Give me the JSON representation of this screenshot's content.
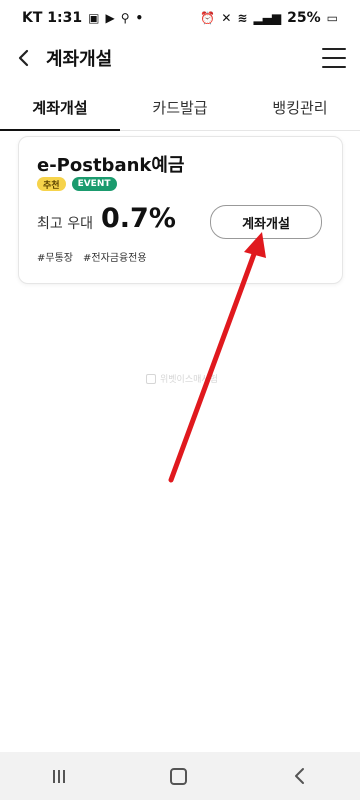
{
  "status_bar": {
    "carrier_time": "KT 1:31",
    "battery": "25%"
  },
  "header": {
    "title": "계좌개설"
  },
  "tabs": [
    {
      "label": "계좌개설",
      "active": true
    },
    {
      "label": "카드발급",
      "active": false
    },
    {
      "label": "뱅킹관리",
      "active": false
    }
  ],
  "card": {
    "product_name": "e-Postbank예금",
    "badges": [
      "추천",
      "EVENT"
    ],
    "rate_label": "최고 우대",
    "rate_value": "0.7%",
    "open_button_label": "계좌개설",
    "tags": [
      "#무통장",
      "#전자금융전용"
    ]
  },
  "watermark": "위벳이스매서험",
  "colors": {
    "badge_recommend": "#f6d34b",
    "badge_event": "#1b9b6e",
    "arrow": "#e0191e"
  }
}
